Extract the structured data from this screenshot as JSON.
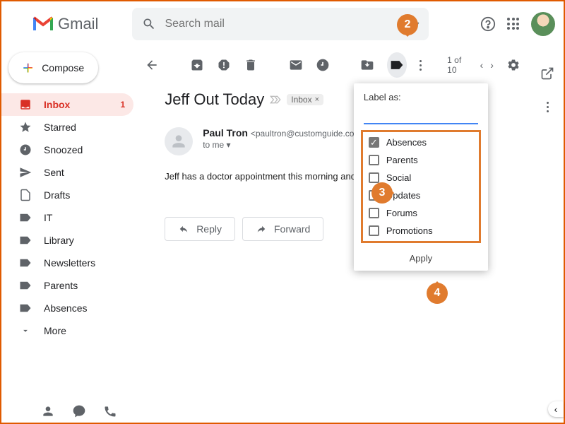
{
  "app": {
    "name": "Gmail"
  },
  "search": {
    "placeholder": "Search mail"
  },
  "compose": {
    "label": "Compose"
  },
  "sidebar": {
    "items": [
      {
        "label": "Inbox",
        "count": "1",
        "icon": "inbox"
      },
      {
        "label": "Starred",
        "icon": "star"
      },
      {
        "label": "Snoozed",
        "icon": "clock"
      },
      {
        "label": "Sent",
        "icon": "send"
      },
      {
        "label": "Drafts",
        "icon": "file"
      },
      {
        "label": "IT",
        "icon": "label"
      },
      {
        "label": "Library",
        "icon": "label"
      },
      {
        "label": "Newsletters",
        "icon": "label"
      },
      {
        "label": "Parents",
        "icon": "label"
      },
      {
        "label": "Absences",
        "icon": "label"
      },
      {
        "label": "More",
        "icon": "expand"
      }
    ]
  },
  "toolbar": {
    "page": "1 of 10"
  },
  "message": {
    "subject": "Jeff Out Today",
    "labelChip": "Inbox",
    "senderName": "Paul Tron",
    "senderEmail": "<paultron@customguide.com>",
    "to": "to me",
    "body": "Jeff has a doctor appointment this morning and wo",
    "reply": "Reply",
    "forward": "Forward"
  },
  "labelMenu": {
    "title": "Label as:",
    "options": [
      {
        "label": "Absences",
        "checked": true
      },
      {
        "label": "Parents",
        "checked": false
      },
      {
        "label": "Social",
        "checked": false
      },
      {
        "label": "Updates",
        "checked": false
      },
      {
        "label": "Forums",
        "checked": false
      },
      {
        "label": "Promotions",
        "checked": false
      }
    ],
    "apply": "Apply"
  },
  "callouts": {
    "c2": "2",
    "c3": "3",
    "c4": "4"
  }
}
